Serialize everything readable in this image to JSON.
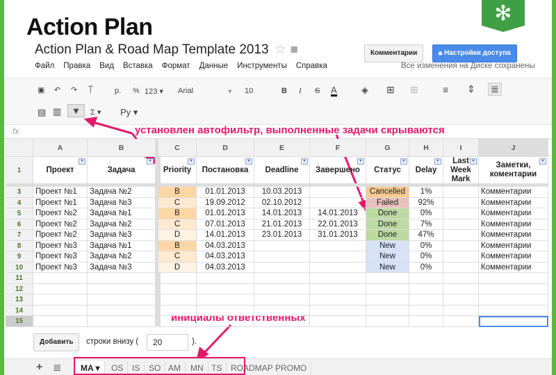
{
  "slide_title": "Action Plan",
  "doc": {
    "title": "Action Plan & Road Map Template 2013",
    "comments": "Комментарии",
    "share": "Настройки доступа",
    "saved": "Все изменения на Диске сохранены"
  },
  "menu": [
    "Файл",
    "Правка",
    "Вид",
    "Вставка",
    "Формат",
    "Данные",
    "Инструменты",
    "Справка"
  ],
  "toolbar": {
    "currency": "р.",
    "percent": "%",
    "format": "123 ▾",
    "font": "Arial",
    "size": "10",
    "bold": "B",
    "italic": "I",
    "strike": "S",
    "textcolor": "A",
    "lang": "Ру ▾",
    "sigma": "Σ ▾",
    "fx": "fx"
  },
  "notes": {
    "filter": "установлен автофильтр, выполненные задачи скрываются",
    "initials": "инициалы ответственных"
  },
  "columns": [
    "A",
    "B",
    "C",
    "D",
    "E",
    "F",
    "G",
    "H",
    "I",
    "J"
  ],
  "headers": [
    "Проект",
    "Задача",
    "Priority",
    "Постановка",
    "Deadline",
    "Завершено",
    "Статус",
    "Delay",
    "Last Week Mark",
    "Заметки, коментарии"
  ],
  "rows": [
    {
      "n": "3",
      "cells": [
        "Проект №1",
        "Задача №2",
        "B",
        "01.01.2013",
        "10.03.2013",
        "",
        "Cancelled",
        "1%",
        "",
        "Комментарии"
      ]
    },
    {
      "n": "4",
      "cells": [
        "Проект №1",
        "Задача №3",
        "C",
        "19.09.2012",
        "02.10.2012",
        "",
        "Failed",
        "92%",
        "",
        "Комментарии"
      ]
    },
    {
      "n": "5",
      "cells": [
        "Проект №2",
        "Задача №1",
        "B",
        "01.01.2013",
        "14.01.2013",
        "14.01.2013",
        "Done",
        "0%",
        "",
        "Комментарии"
      ]
    },
    {
      "n": "6",
      "cells": [
        "Проект №2",
        "Задача №2",
        "C",
        "07.01.2013",
        "21.01.2013",
        "22.01.2013",
        "Done",
        "7%",
        "",
        "Комментарии"
      ]
    },
    {
      "n": "7",
      "cells": [
        "Проект №2",
        "Задача №3",
        "D",
        "14.01.2013",
        "23.01.2013",
        "31.01.2013",
        "Done",
        "47%",
        "",
        "Комментарии"
      ]
    },
    {
      "n": "8",
      "cells": [
        "Проект №3",
        "Задача №1",
        "B",
        "04.03.2013",
        "",
        "",
        "New",
        "0%",
        "",
        "Комментарии"
      ]
    },
    {
      "n": "9",
      "cells": [
        "Проект №3",
        "Задача №2",
        "C",
        "04.03.2013",
        "",
        "",
        "New",
        "0%",
        "",
        "Комментарии"
      ]
    },
    {
      "n": "10",
      "cells": [
        "Проект №3",
        "Задача №3",
        "D",
        "04.03.2013",
        "",
        "",
        "New",
        "0%",
        "",
        "Комментарии"
      ]
    }
  ],
  "empty_rows": [
    "11",
    "12",
    "13",
    "14",
    "15"
  ],
  "header_row_num": "1",
  "colors": {
    "B": "#fcd6a4",
    "C": "#fde9d0",
    "D": "#fef3e4",
    "Cancelled": "#f9c98f",
    "Failed": "#e8c0bb",
    "Done": "#bcd9a2",
    "New": "#d6e2f8"
  },
  "footer": {
    "add": "Добавить",
    "rows_label": "строки внизу (",
    "rows_value": "20",
    "rows_close": ")."
  },
  "tabs": [
    "MA ▾",
    "OS",
    "IS",
    "SO",
    "AM",
    "MN",
    "TS",
    "ROADMAP",
    "PROMO"
  ]
}
